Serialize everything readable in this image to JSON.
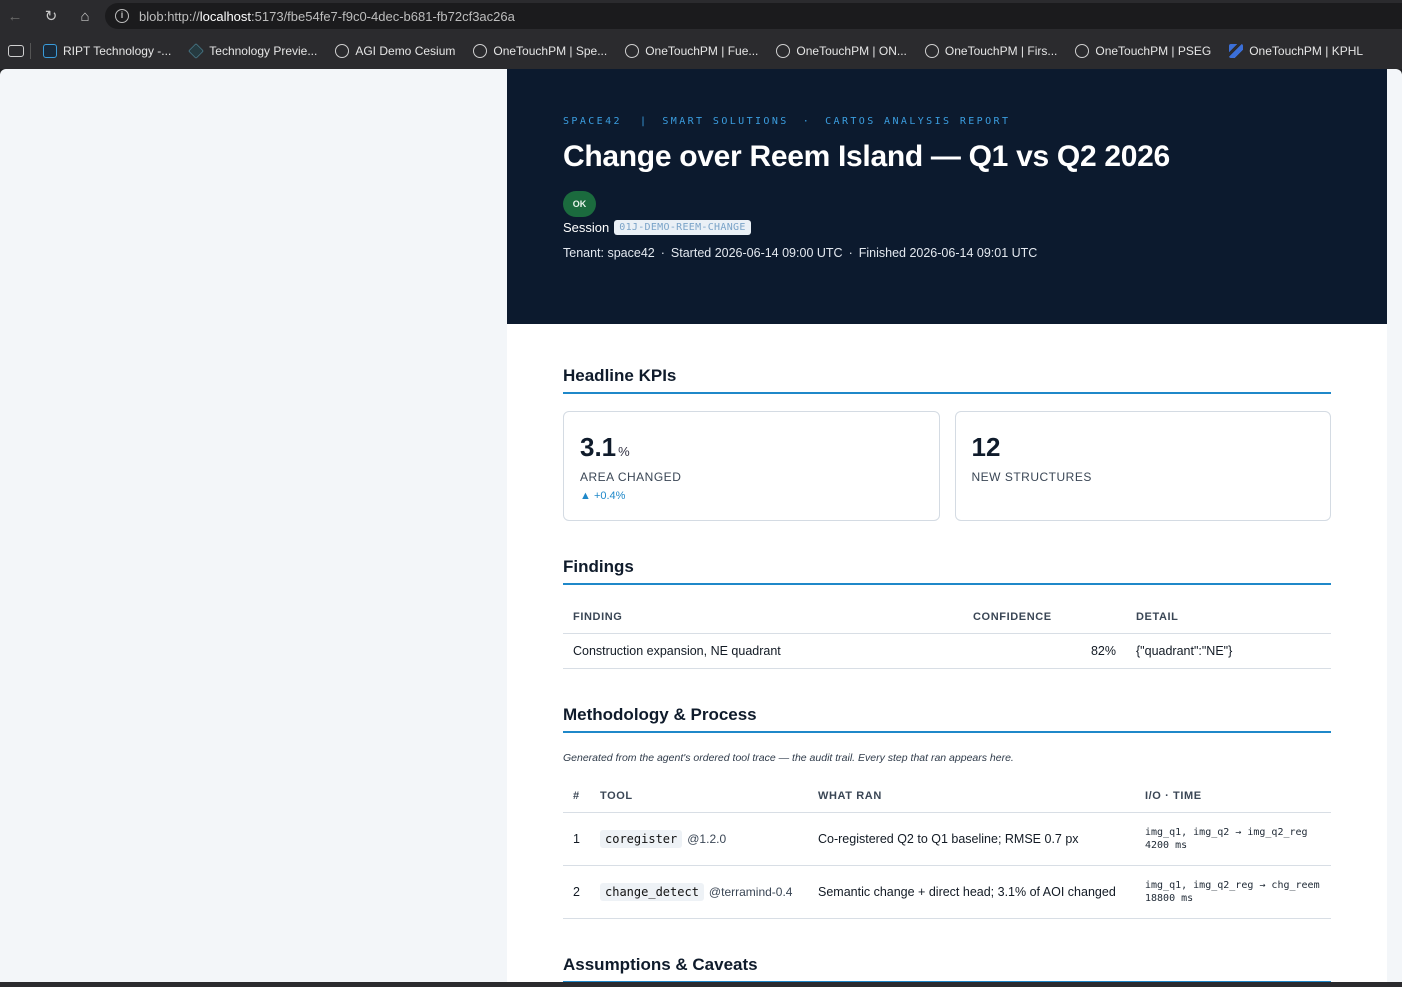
{
  "browser": {
    "url_prefix": "blob:http://",
    "url_host": "localhost",
    "url_rest": ":5173/fbe54fe7-f9c0-4dec-b681-fb72cf3ac26a",
    "bookmarks": [
      {
        "label": "RIPT Technology -...",
        "icon": "square-icon"
      },
      {
        "label": "Technology Previe...",
        "icon": "tp-icon"
      },
      {
        "label": "AGI Demo Cesium",
        "icon": "globe-icon"
      },
      {
        "label": "OneTouchPM | Spe...",
        "icon": "globe-icon"
      },
      {
        "label": "OneTouchPM | Fue...",
        "icon": "globe-icon"
      },
      {
        "label": "OneTouchPM | ON...",
        "icon": "globe-icon"
      },
      {
        "label": "OneTouchPM | Firs...",
        "icon": "globe-icon"
      },
      {
        "label": "OneTouchPM | PSEG",
        "icon": "globe-icon"
      },
      {
        "label": "OneTouchPM | KPHL",
        "icon": "kphl-icon"
      }
    ]
  },
  "report": {
    "eyebrow": {
      "brand": "SPACE42",
      "sep": "|",
      "division": "SMART SOLUTIONS",
      "dot": "·",
      "kind": "CARTOS ANALYSIS REPORT"
    },
    "title": "Change over Reem Island — Q1 vs Q2 2026",
    "status": "OK",
    "session_label": "Session",
    "session_id": "01J-DEMO-REEM-CHANGE",
    "tenant": "Tenant: space42",
    "started": "Started 2026-06-14 09:00 UTC",
    "finished": "Finished 2026-06-14 09:01 UTC",
    "meta_dot": "·",
    "kpi_heading": "Headline KPIs",
    "kpis": [
      {
        "value": "3.1",
        "unit": "%",
        "label": "AREA CHANGED",
        "delta": "▲ +0.4%"
      },
      {
        "value": "12",
        "unit": "",
        "label": "NEW STRUCTURES",
        "delta": ""
      }
    ],
    "findings_heading": "Findings",
    "findings_columns": [
      "FINDING",
      "CONFIDENCE",
      "DETAIL"
    ],
    "findings": [
      {
        "finding": "Construction expansion, NE quadrant",
        "confidence": "82%",
        "detail": "{\"quadrant\":\"NE\"}"
      }
    ],
    "method_heading": "Methodology & Process",
    "method_note": "Generated from the agent's ordered tool trace — the audit trail. Every step that ran appears here.",
    "method_columns": [
      "#",
      "TOOL",
      "WHAT RAN",
      "I/O · TIME"
    ],
    "steps": [
      {
        "n": "1",
        "tool": "coregister",
        "version": "@1.2.0",
        "what": "Co-registered Q2 to Q1 baseline; RMSE 0.7 px",
        "io": "img_q1, img_q2 → img_q2_reg",
        "time": "4200 ms"
      },
      {
        "n": "2",
        "tool": "change_detect",
        "version": "@terramind-0.4",
        "what": "Semantic change + direct head; 3.1% of AOI changed",
        "io": "img_q1, img_q2_reg → chg_reem",
        "time": "18800 ms"
      }
    ],
    "assumptions_heading": "Assumptions & Caveats"
  }
}
